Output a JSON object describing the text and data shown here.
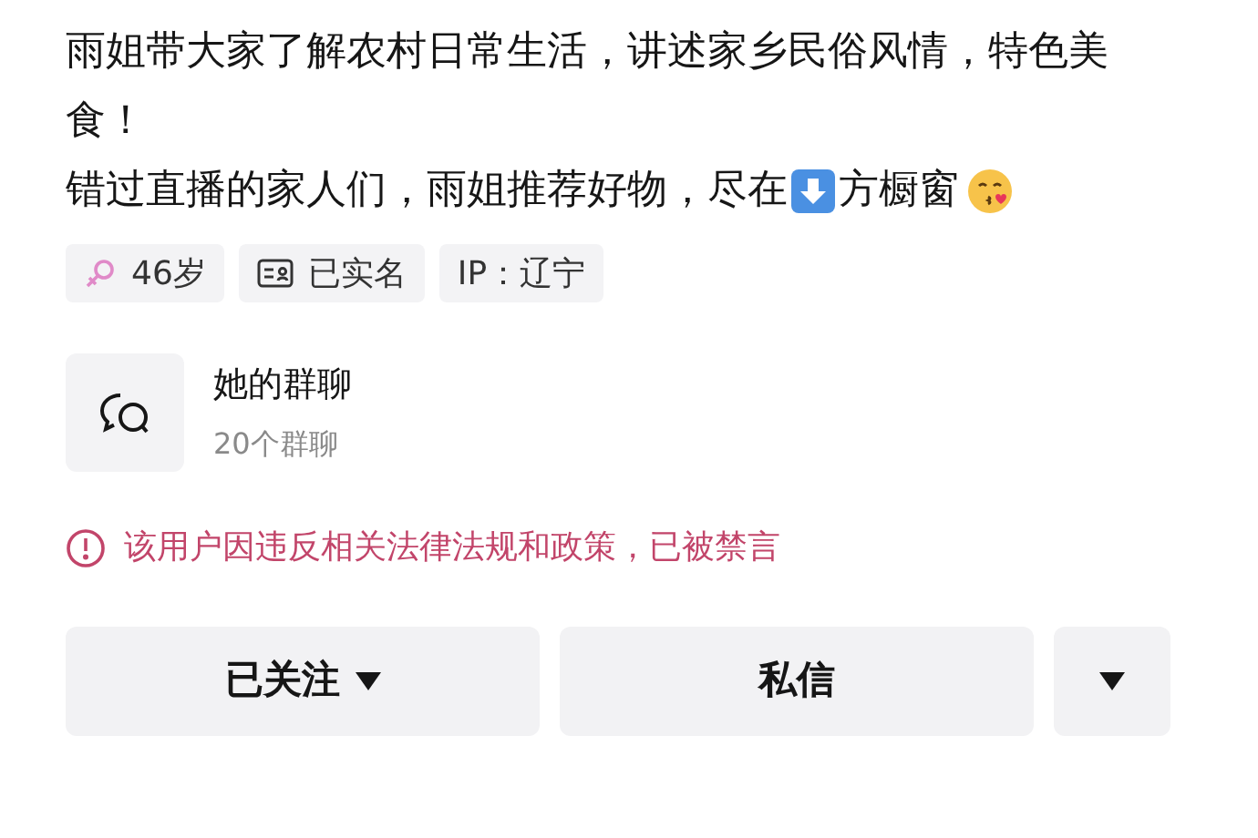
{
  "bio": {
    "line_1": "雨姐带大家了解农村日常生活，讲述家乡民俗风情，特色美食！",
    "line_2_before": "错过直播的家人们，雨姐推荐好物，尽在",
    "line_2_after": "方橱窗"
  },
  "tags": [
    {
      "kind": "age",
      "label": "46岁"
    },
    {
      "kind": "verified",
      "label": "已实名"
    },
    {
      "kind": "plain",
      "label": "IP：辽宁"
    }
  ],
  "group_chat": {
    "title": "她的群聊",
    "subtitle": "20个群聊"
  },
  "notice": "该用户因违反相关法律法规和政策，已被禁言",
  "buttons": [
    {
      "kind": "follow",
      "label": "已关注"
    },
    {
      "kind": "message",
      "label": "私信"
    },
    {
      "kind": "more"
    }
  ]
}
